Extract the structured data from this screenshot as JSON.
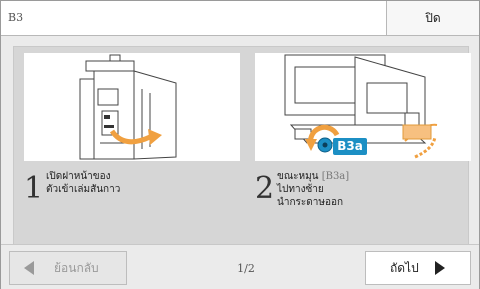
{
  "header": {
    "title": "B3",
    "close_label": "ปิด"
  },
  "steps": [
    {
      "number": "1",
      "lines": [
        "เปิดฝาหน้าของ",
        "ตัวเข้าเล่มสันกาว"
      ]
    },
    {
      "number": "2",
      "line1_prefix": "ขณะหมุน ",
      "line1_code": "[B3a]",
      "lines": [
        "ไปทางซ้าย",
        "นำกระดาษออก"
      ]
    }
  ],
  "illustration": {
    "callout_label": "B3a",
    "accent_color": "#f0a040",
    "callout_color": "#1c8fc4"
  },
  "footer": {
    "back_label": "ย้อนกลับ",
    "pager": "1/2",
    "next_label": "ถัดไป"
  }
}
